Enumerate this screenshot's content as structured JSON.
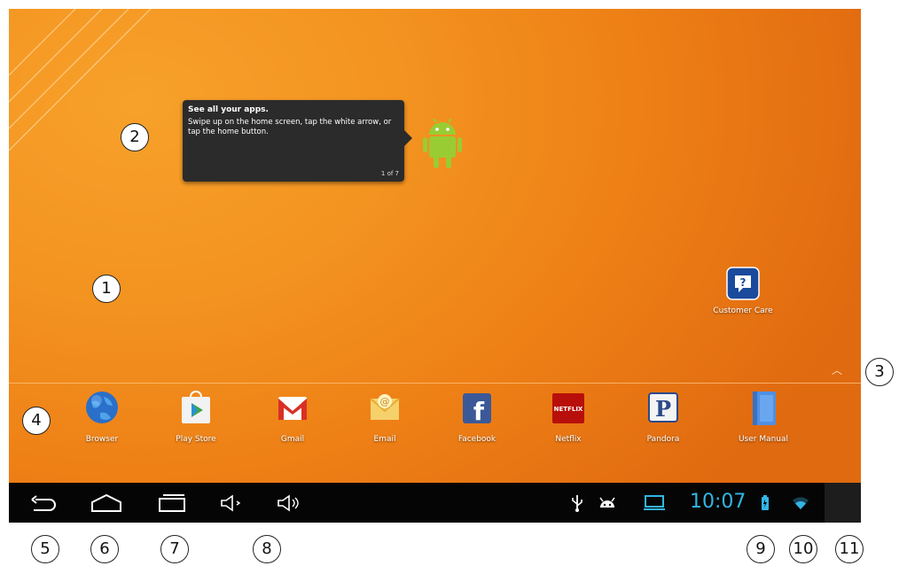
{
  "tooltip": {
    "title": "See all your apps.",
    "body": "Swipe up on the home screen, tap the white arrow, or tap the home button.",
    "page": "1 of 7"
  },
  "desktop_icon": {
    "label": "Customer Care",
    "icon": "customer-care-question-icon"
  },
  "dock_apps": [
    {
      "label": "Browser",
      "icon": "globe-icon"
    },
    {
      "label": "Play Store",
      "icon": "play-store-icon"
    },
    {
      "label": "Gmail",
      "icon": "gmail-icon"
    },
    {
      "label": "Email",
      "icon": "email-icon"
    },
    {
      "label": "Facebook",
      "icon": "facebook-icon"
    },
    {
      "label": "Netflix",
      "icon": "netflix-icon",
      "icon_text": "NETFLIX"
    },
    {
      "label": "Pandora",
      "icon": "pandora-icon",
      "icon_text": "P"
    },
    {
      "label": "User Manual",
      "icon": "book-icon"
    }
  ],
  "status_bar": {
    "time": "10:07",
    "icons": [
      "usb-icon",
      "android-debug-icon",
      "screen-icon",
      "battery-icon",
      "wifi-icon"
    ]
  },
  "nav_buttons": [
    "back-icon",
    "home-icon",
    "recent-apps-icon",
    "volume-down-icon",
    "volume-up-icon"
  ],
  "markers": [
    "1",
    "2",
    "3",
    "4",
    "5",
    "6",
    "7",
    "8",
    "9",
    "10",
    "11"
  ],
  "colors": {
    "wallpaper": "#f39320",
    "navbar": "#050505",
    "clock": "#33b5e5"
  }
}
